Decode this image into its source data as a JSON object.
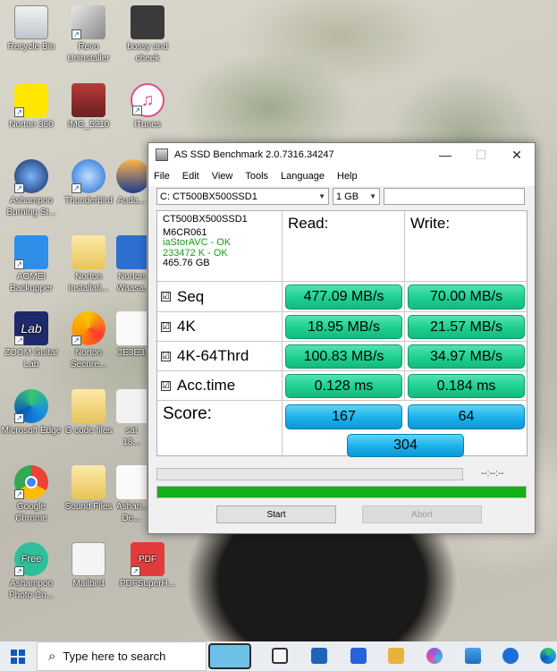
{
  "desktop": {
    "icons": [
      {
        "label": "Recycle Bin"
      },
      {
        "label": "Revo Uninstaller"
      },
      {
        "label": "bossy and cheek"
      },
      {
        "label": "Norton 360"
      },
      {
        "label": "IMG_5210"
      },
      {
        "label": "iTunes"
      },
      {
        "label": "Ashampoo Burning St..."
      },
      {
        "label": "Thunderbird"
      },
      {
        "label": "Auda..."
      },
      {
        "label": "AOMEI Backupper"
      },
      {
        "label": "Norton Installati..."
      },
      {
        "label": "Norton Waasa..."
      },
      {
        "label": "ZOOM Guitar Lab"
      },
      {
        "label": "Norton Secure..."
      },
      {
        "label": "CE3E3..."
      },
      {
        "label": "Microsoft Edge"
      },
      {
        "label": "G code files"
      },
      {
        "label": "sat 18..."
      },
      {
        "label": "Google Chrome"
      },
      {
        "label": "Sound Files"
      },
      {
        "label": "Ashan... De..."
      },
      {
        "label": "Ashampoo Photo Co..."
      },
      {
        "label": "Mailbird"
      },
      {
        "label": "PDFSuperH..."
      }
    ]
  },
  "window": {
    "title": "AS SSD Benchmark 2.0.7316.34247",
    "controls": {
      "minimize": "—",
      "maximize": "☐",
      "close": "✕"
    },
    "menu": [
      "File",
      "Edit",
      "View",
      "Tools",
      "Language",
      "Help"
    ],
    "drive_select": "C: CT500BX500SSD1",
    "size_select": "1 GB",
    "search_value": "",
    "info": {
      "model": "CT500BX500SSD1",
      "firmware": "M6CR061",
      "driver": "iaStorAVC - OK",
      "alignment": "233472 K - OK",
      "capacity": "465.76 GB"
    },
    "headers": {
      "read": "Read:",
      "write": "Write:"
    },
    "tests": [
      {
        "check": "☑",
        "name": "Seq",
        "read": "477.09 MB/s",
        "write": "70.00 MB/s"
      },
      {
        "check": "☑",
        "name": "4K",
        "read": "18.95 MB/s",
        "write": "21.57 MB/s"
      },
      {
        "check": "☑",
        "name": "4K-64Thrd",
        "read": "100.83 MB/s",
        "write": "34.97 MB/s"
      },
      {
        "check": "☑",
        "name": "Acc.time",
        "read": "0.128 ms",
        "write": "0.184 ms"
      }
    ],
    "score": {
      "label": "Score:",
      "read": "167",
      "write": "64",
      "total": "304"
    },
    "progress": {
      "time": "--:--:--",
      "overall_fraction": 1.0
    },
    "buttons": {
      "start": "Start",
      "abort": "Abort"
    }
  },
  "taskbar": {
    "search_placeholder": "Type here to search"
  },
  "colors": {
    "result_green": "#1dcf90",
    "score_blue": "#1ab0ea",
    "progress_green": "#11b117"
  }
}
